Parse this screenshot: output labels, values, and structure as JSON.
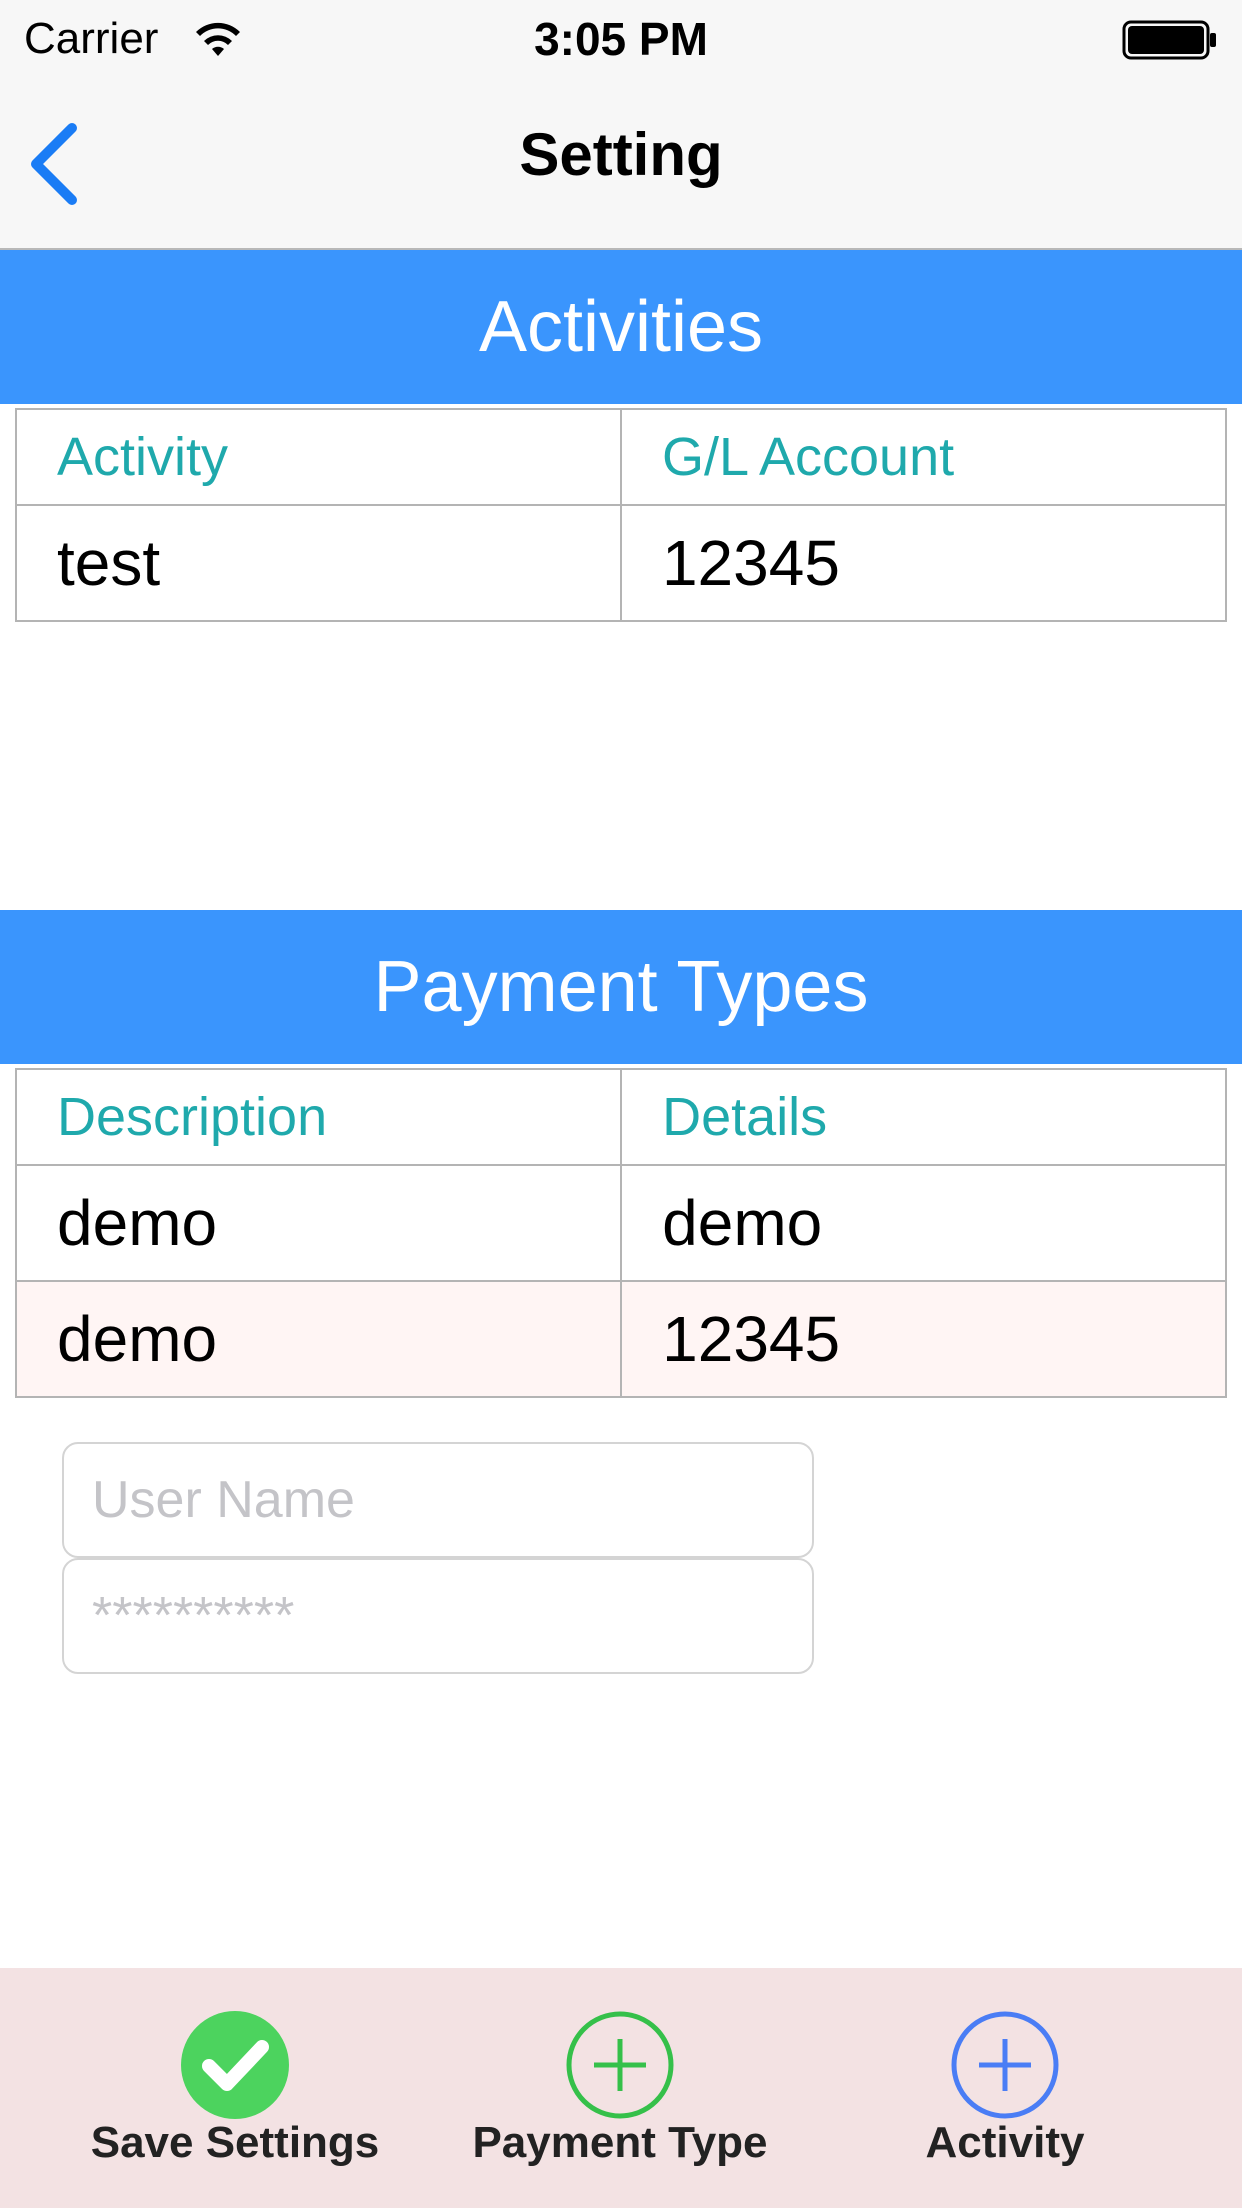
{
  "status_bar": {
    "carrier": "Carrier",
    "time": "3:05 PM",
    "wifi_icon": "wifi-icon",
    "battery_icon": "battery-icon"
  },
  "nav": {
    "title": "Setting",
    "back_icon": "chevron-left-icon",
    "accent_color": "#1a7cf5"
  },
  "activities": {
    "header": "Activities",
    "columns": [
      "Activity",
      "G/L Account"
    ],
    "rows": [
      [
        "test",
        "12345"
      ]
    ]
  },
  "payment_types": {
    "header": "Payment Types",
    "columns": [
      "Description",
      "Details"
    ],
    "rows": [
      [
        "demo",
        "demo"
      ],
      [
        "demo",
        "12345"
      ]
    ]
  },
  "login": {
    "username_placeholder": "User Name",
    "username_value": "",
    "password_placeholder": "**********",
    "password_value": ""
  },
  "toolbar": {
    "save_label": "Save Settings",
    "save_icon": "check-circle-icon",
    "payment_label": "Payment Type",
    "payment_icon": "plus-circle-icon",
    "activity_label": "Activity",
    "activity_icon": "plus-circle-icon"
  },
  "colors": {
    "section_header_bg": "#3a95fd",
    "column_header_text": "#1fa9ac",
    "toolbar_bg": "#f3e2e3",
    "save_green": "#4cd35e",
    "payment_green": "#35c04a",
    "activity_blue": "#4a7df5"
  }
}
